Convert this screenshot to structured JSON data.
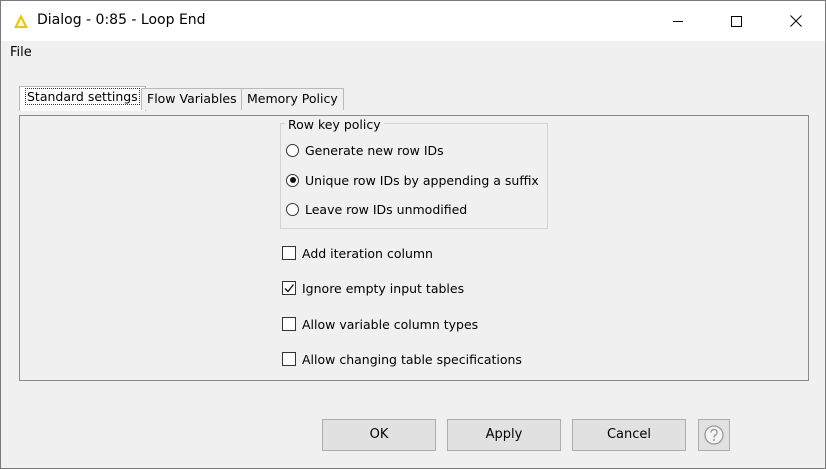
{
  "window": {
    "title": "Dialog - 0:85 - Loop End"
  },
  "menu": {
    "file": "File"
  },
  "tabs": [
    {
      "label": "Standard settings",
      "active": true
    },
    {
      "label": "Flow Variables",
      "active": false
    },
    {
      "label": "Memory Policy",
      "active": false
    }
  ],
  "row_key_policy": {
    "title": "Row key policy",
    "options": [
      {
        "label": "Generate new row IDs",
        "selected": false
      },
      {
        "label": "Unique row IDs by appending a suffix",
        "selected": true
      },
      {
        "label": "Leave row IDs unmodified",
        "selected": false
      }
    ]
  },
  "checkboxes": [
    {
      "label": "Add iteration column",
      "checked": false
    },
    {
      "label": "Ignore empty input tables",
      "checked": true
    },
    {
      "label": "Allow variable column types",
      "checked": false
    },
    {
      "label": "Allow changing table specifications",
      "checked": false
    }
  ],
  "buttons": {
    "ok": "OK",
    "apply": "Apply",
    "cancel": "Cancel"
  },
  "icons": {
    "app": "knime-triangle-icon",
    "help": "help-icon"
  },
  "colors": {
    "app_icon": "#f5c400"
  }
}
